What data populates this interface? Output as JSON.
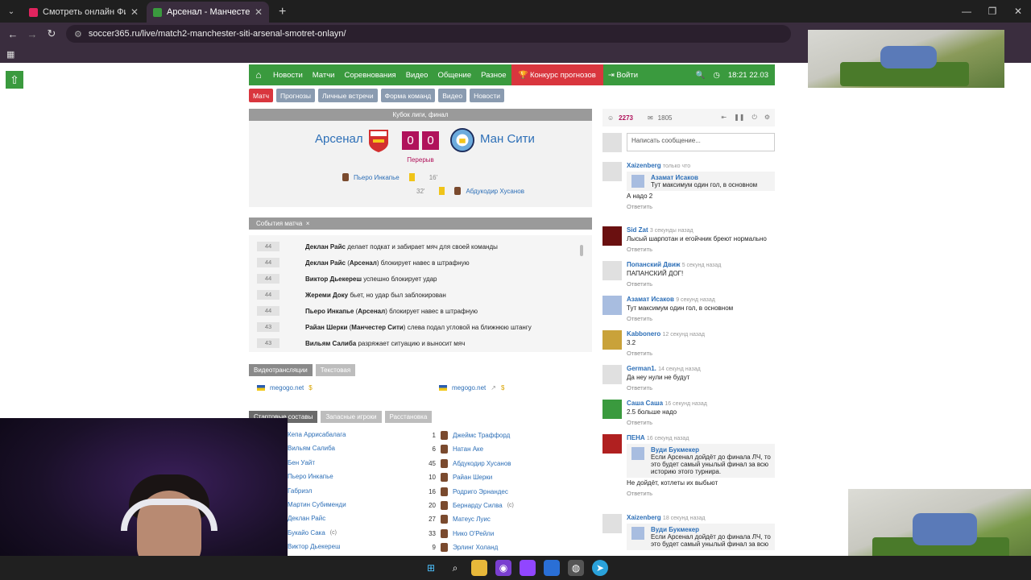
{
  "browser": {
    "tabs": [
      {
        "title": "Смотреть онлайн Финал Кубка",
        "favicon_color": "#e0245e"
      },
      {
        "title": "Арсенал - Манчестер Сити: смо",
        "favicon_color": "#3a9a3e"
      }
    ],
    "url": "soccer365.ru/live/match2-manchester-siti-arsenal-smotret-onlayn/"
  },
  "site": {
    "nav": [
      "Новости",
      "Матчи",
      "Соревнования",
      "Видео",
      "Общение",
      "Разное"
    ],
    "contest": "Конкурс прогнозов",
    "login": "Войти",
    "time": "18:21 22.03",
    "subnav": [
      "Матч",
      "Прогнозы",
      "Личные встречи",
      "Форма команд",
      "Видео",
      "Новости"
    ]
  },
  "match": {
    "competition": "Кубок лиги, финал",
    "home": "Арсенал",
    "away": "Ман Сити",
    "home_score": "0",
    "away_score": "0",
    "status": "Перерыв",
    "cards": [
      {
        "player": "Пьеро Инкапье",
        "minute": "16'"
      },
      {
        "player": "Абдукодир Хусанов",
        "minute": "32'"
      }
    ]
  },
  "events": {
    "header": "События матча",
    "close": "×",
    "items": [
      {
        "min": "44",
        "who": "Деклан Райс",
        "team": "",
        "text": "делает подкат и забирает мяч для своей команды"
      },
      {
        "min": "44",
        "who": "Деклан Райс",
        "team": "Арсенал",
        "text": "блокирует навес в штрафную"
      },
      {
        "min": "44",
        "who": "Виктор Дьекереш",
        "team": "",
        "text": "успешно блокирует удар"
      },
      {
        "min": "44",
        "who": "Жереми Доку",
        "team": "",
        "text": "бьет, но удар был заблокирован"
      },
      {
        "min": "44",
        "who": "Пьеро Инкапье",
        "team": "Арсенал",
        "text": "блокирует навес в штрафную"
      },
      {
        "min": "43",
        "who": "Райан Шерки",
        "team": "Манчестер Сити",
        "text": "слева подал угловой на ближнюю штангу"
      },
      {
        "min": "43",
        "who": "Вильям Салиба",
        "team": "",
        "text": "разряжает ситуацию и выносит мяч"
      }
    ]
  },
  "video": {
    "tabs": [
      "Видеотрансляции",
      "Текстовая"
    ],
    "links": [
      {
        "name": "megogo.net",
        "price": "$"
      },
      {
        "name": "megogo.net",
        "price": "$"
      }
    ]
  },
  "lineups": {
    "tabs": [
      "Стартовые составы",
      "Запасные игроки",
      "Расстановка"
    ],
    "home": [
      "Кепа Аррисабалага",
      "Вильям Салиба",
      "Бен Уайт",
      "Пьеро Инкапье",
      "Габриэл",
      "Мартин Субименди",
      "Деклан Райс",
      "Букайо Сака",
      "Виктор Дьекереш"
    ],
    "home_cap": "(с)",
    "away": [
      {
        "num": "1",
        "name": "Джеймс Траффорд"
      },
      {
        "num": "6",
        "name": "Натан Аке"
      },
      {
        "num": "45",
        "name": "Абдукодир Хусанов"
      },
      {
        "num": "10",
        "name": "Райан Шерки"
      },
      {
        "num": "16",
        "name": "Родриго Эрнандес"
      },
      {
        "num": "20",
        "name": "Бернарду Силва"
      },
      {
        "num": "27",
        "name": "Матеус Луис"
      },
      {
        "num": "33",
        "name": "Нико О'Рейли"
      },
      {
        "num": "9",
        "name": "Эрлинг Холанд"
      }
    ],
    "away_cap": "(с)"
  },
  "chat": {
    "online": "2273",
    "messages_count": "1805",
    "input_placeholder": "Написать сообщение...",
    "reply": "Ответить",
    "messages": [
      {
        "name": "Xaizenberg",
        "ago": "только что",
        "quote_name": "Азамат Исаков",
        "quote": "Тут максимум один гол, в основном",
        "text": "А надо 2"
      },
      {
        "name": "Sid Zat",
        "ago": "3 секунды назад",
        "text": "Лысый шарпотан и егойчник бреют нормально"
      },
      {
        "name": "Попанский Движ",
        "ago": "5 секунд назад",
        "text": "ПАПАНСКИЙ ДОГ!"
      },
      {
        "name": "Азамат Исаков",
        "ago": "9 секунд назад",
        "text": "Тут максимум один гол, в основном"
      },
      {
        "name": "Kabbonero",
        "ago": "12 секунд назад",
        "text": "3.2"
      },
      {
        "name": "German1.",
        "ago": "14 секунд назад",
        "text": "Да неу нули не будут"
      },
      {
        "name": "Саша Саша",
        "ago": "16 секунд назад",
        "text": "2.5 больше надо"
      },
      {
        "name": "ПЕНА",
        "ago": "16 секунд назад",
        "quote_name": "Вуди Букмекер",
        "quote": "Если Арсенал дойдёт до финала ЛЧ, то это будет самый унылый финал за всю историю этого турнира.",
        "text": "Не дойдёт, котлеты их выбьют"
      },
      {
        "name": "Xaizenberg",
        "ago": "18 секунд назад",
        "quote_name": "Вуди Букмекер",
        "quote": "Если Арсенал дойдёт до финала ЛЧ, то это будет самый унылый финал за всю",
        "text": ""
      }
    ]
  }
}
